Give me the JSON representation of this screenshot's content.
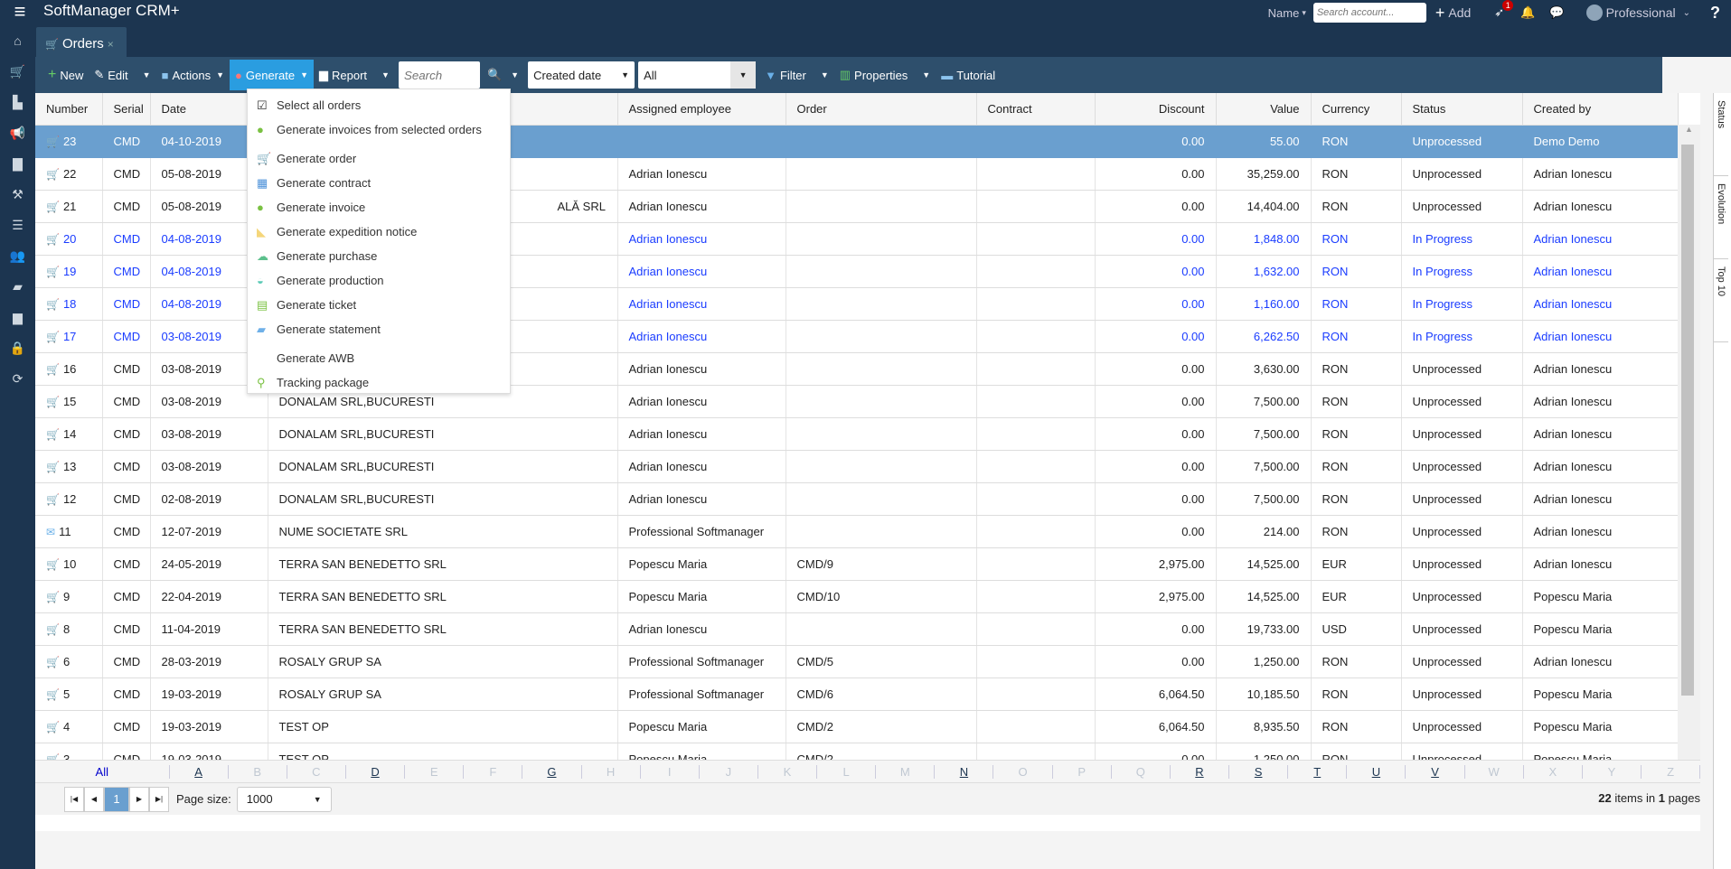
{
  "app": {
    "title": "SoftManager CRM+",
    "menu_icon": "hamburger-icon"
  },
  "header": {
    "name_label": "Name",
    "search_placeholder": "Search account...",
    "add_label": "Add",
    "notif_badge": "1",
    "user": "Professional",
    "help": "?"
  },
  "tab": {
    "label": "Orders",
    "close": "×"
  },
  "sidebar": [
    "home-icon",
    "cart-icon",
    "chart-icon",
    "megaphone-icon",
    "briefcase-icon",
    "hammer-icon",
    "database-icon",
    "users-icon",
    "folder-icon",
    "printer-icon",
    "lock-icon",
    "refresh-icon"
  ],
  "toolbar": {
    "new": "New",
    "edit": "Edit",
    "actions": "Actions",
    "generate": "Generate",
    "report": "Report",
    "search_placeholder": "Search",
    "date_filter": "Created date",
    "period": "All",
    "filter": "Filter",
    "properties": "Properties",
    "tutorial": "Tutorial"
  },
  "generate_menu": [
    {
      "label": "Select all orders",
      "icon": "checkbox-icon",
      "glyph": "☑",
      "color": "#333"
    },
    {
      "label": "Generate invoices from selected orders",
      "icon": "money-bag-icon",
      "glyph": "●",
      "color": "#7ac142"
    },
    {
      "label": "Generate order",
      "icon": "cart-icon",
      "glyph": "🛒",
      "color": "#36b39a",
      "gap": true
    },
    {
      "label": "Generate contract",
      "icon": "contract-icon",
      "glyph": "▦",
      "color": "#4a90d9"
    },
    {
      "label": "Generate invoice",
      "icon": "money-bag-icon",
      "glyph": "●",
      "color": "#7ac142"
    },
    {
      "label": "Generate expedition notice",
      "icon": "dolly-icon",
      "glyph": "◣",
      "color": "#f5d67a"
    },
    {
      "label": "Generate purchase",
      "icon": "cloud-upload-icon",
      "glyph": "☁",
      "color": "#5cc08c"
    },
    {
      "label": "Generate production",
      "icon": "helmet-icon",
      "glyph": "◒",
      "color": "#5ccab6"
    },
    {
      "label": "Generate ticket",
      "icon": "ticket-icon",
      "glyph": "▤",
      "color": "#7ac142"
    },
    {
      "label": "Generate statement",
      "icon": "statement-icon",
      "glyph": "▰",
      "color": "#6fb0e8"
    },
    {
      "label": "Generate AWB",
      "icon": "",
      "glyph": "",
      "color": "#333",
      "gap": true
    },
    {
      "label": "Tracking package",
      "icon": "location-pin-icon",
      "glyph": "⚲",
      "color": "#7ac142"
    }
  ],
  "table": {
    "columns": [
      "Number",
      "Serial",
      "Date",
      "",
      "Assigned employee",
      "Order",
      "Contract",
      "Discount",
      "Value",
      "Currency",
      "Status",
      "Created by"
    ],
    "rows": [
      {
        "n": "23",
        "s": "CMD",
        "d": "04-10-2019",
        "c": "",
        "e": "",
        "o": "",
        "k": "",
        "disc": "0.00",
        "v": "55.00",
        "cur": "RON",
        "st": "Unprocessed",
        "by": "Demo Demo",
        "sel": true
      },
      {
        "n": "22",
        "s": "CMD",
        "d": "05-08-2019",
        "c": "",
        "e": "Adrian Ionescu",
        "o": "",
        "k": "",
        "disc": "0.00",
        "v": "35,259.00",
        "cur": "RON",
        "st": "Unprocessed",
        "by": "Adrian Ionescu"
      },
      {
        "n": "21",
        "s": "CMD",
        "d": "05-08-2019",
        "c": "ALĂ SRL",
        "e": "Adrian Ionescu",
        "o": "",
        "k": "",
        "disc": "0.00",
        "v": "14,404.00",
        "cur": "RON",
        "st": "Unprocessed",
        "by": "Adrian Ionescu"
      },
      {
        "n": "20",
        "s": "CMD",
        "d": "04-08-2019",
        "c": "",
        "e": "Adrian Ionescu",
        "o": "",
        "k": "",
        "disc": "0.00",
        "v": "1,848.00",
        "cur": "RON",
        "st": "In Progress",
        "by": "Adrian Ionescu",
        "prog": true
      },
      {
        "n": "19",
        "s": "CMD",
        "d": "04-08-2019",
        "c": "",
        "e": "Adrian Ionescu",
        "o": "",
        "k": "",
        "disc": "0.00",
        "v": "1,632.00",
        "cur": "RON",
        "st": "In Progress",
        "by": "Adrian Ionescu",
        "prog": true
      },
      {
        "n": "18",
        "s": "CMD",
        "d": "04-08-2019",
        "c": "",
        "e": "Adrian Ionescu",
        "o": "",
        "k": "",
        "disc": "0.00",
        "v": "1,160.00",
        "cur": "RON",
        "st": "In Progress",
        "by": "Adrian Ionescu",
        "prog": true
      },
      {
        "n": "17",
        "s": "CMD",
        "d": "03-08-2019",
        "c": "",
        "e": "Adrian Ionescu",
        "o": "",
        "k": "",
        "disc": "0.00",
        "v": "6,262.50",
        "cur": "RON",
        "st": "In Progress",
        "by": "Adrian Ionescu",
        "prog": true
      },
      {
        "n": "16",
        "s": "CMD",
        "d": "03-08-2019",
        "c": "",
        "e": "Adrian Ionescu",
        "o": "",
        "k": "",
        "disc": "0.00",
        "v": "3,630.00",
        "cur": "RON",
        "st": "Unprocessed",
        "by": "Adrian Ionescu"
      },
      {
        "n": "15",
        "s": "CMD",
        "d": "03-08-2019",
        "c": "DONALAM SRL,BUCURESTI",
        "e": "Adrian Ionescu",
        "o": "",
        "k": "",
        "disc": "0.00",
        "v": "7,500.00",
        "cur": "RON",
        "st": "Unprocessed",
        "by": "Adrian Ionescu"
      },
      {
        "n": "14",
        "s": "CMD",
        "d": "03-08-2019",
        "c": "DONALAM SRL,BUCURESTI",
        "e": "Adrian Ionescu",
        "o": "",
        "k": "",
        "disc": "0.00",
        "v": "7,500.00",
        "cur": "RON",
        "st": "Unprocessed",
        "by": "Adrian Ionescu"
      },
      {
        "n": "13",
        "s": "CMD",
        "d": "03-08-2019",
        "c": "DONALAM SRL,BUCURESTI",
        "e": "Adrian Ionescu",
        "o": "",
        "k": "",
        "disc": "0.00",
        "v": "7,500.00",
        "cur": "RON",
        "st": "Unprocessed",
        "by": "Adrian Ionescu"
      },
      {
        "n": "12",
        "s": "CMD",
        "d": "02-08-2019",
        "c": "DONALAM SRL,BUCURESTI",
        "e": "Adrian Ionescu",
        "o": "",
        "k": "",
        "disc": "0.00",
        "v": "7,500.00",
        "cur": "RON",
        "st": "Unprocessed",
        "by": "Adrian Ionescu"
      },
      {
        "n": "11",
        "s": "CMD",
        "d": "12-07-2019",
        "c": "NUME SOCIETATE SRL",
        "e": "Professional Softmanager",
        "o": "",
        "k": "",
        "disc": "0.00",
        "v": "214.00",
        "cur": "RON",
        "st": "Unprocessed",
        "by": "Adrian Ionescu",
        "mail": true
      },
      {
        "n": "10",
        "s": "CMD",
        "d": "24-05-2019",
        "c": "TERRA SAN BENEDETTO SRL",
        "e": "Popescu Maria",
        "o": "CMD/9",
        "k": "",
        "disc": "2,975.00",
        "v": "14,525.00",
        "cur": "EUR",
        "st": "Unprocessed",
        "by": "Adrian Ionescu"
      },
      {
        "n": "9",
        "s": "CMD",
        "d": "22-04-2019",
        "c": "TERRA SAN BENEDETTO SRL",
        "e": "Popescu Maria",
        "o": "CMD/10",
        "k": "",
        "disc": "2,975.00",
        "v": "14,525.00",
        "cur": "EUR",
        "st": "Unprocessed",
        "by": "Popescu Maria"
      },
      {
        "n": "8",
        "s": "CMD",
        "d": "11-04-2019",
        "c": "TERRA SAN BENEDETTO SRL",
        "e": "Adrian Ionescu",
        "o": "",
        "k": "",
        "disc": "0.00",
        "v": "19,733.00",
        "cur": "USD",
        "st": "Unprocessed",
        "by": "Popescu Maria"
      },
      {
        "n": "6",
        "s": "CMD",
        "d": "28-03-2019",
        "c": "ROSALY GRUP SA",
        "e": "Professional Softmanager",
        "o": "CMD/5",
        "k": "",
        "disc": "0.00",
        "v": "1,250.00",
        "cur": "RON",
        "st": "Unprocessed",
        "by": "Adrian Ionescu"
      },
      {
        "n": "5",
        "s": "CMD",
        "d": "19-03-2019",
        "c": "ROSALY GRUP SA",
        "e": "Professional Softmanager",
        "o": "CMD/6",
        "k": "",
        "disc": "6,064.50",
        "v": "10,185.50",
        "cur": "RON",
        "st": "Unprocessed",
        "by": "Popescu Maria"
      },
      {
        "n": "4",
        "s": "CMD",
        "d": "19-03-2019",
        "c": "TEST OP",
        "e": "Popescu Maria",
        "o": "CMD/2",
        "k": "",
        "disc": "6,064.50",
        "v": "8,935.50",
        "cur": "RON",
        "st": "Unprocessed",
        "by": "Popescu Maria"
      },
      {
        "n": "3",
        "s": "CMD",
        "d": "19-03-2019",
        "c": "TEST OP",
        "e": "Popescu Maria",
        "o": "CMD/2",
        "k": "",
        "disc": "0.00",
        "v": "1,250.00",
        "cur": "RON",
        "st": "Unprocessed",
        "by": "Popescu Maria"
      }
    ]
  },
  "alphabet": {
    "all": "All",
    "letters": [
      "A",
      "B",
      "C",
      "D",
      "E",
      "F",
      "G",
      "H",
      "I",
      "J",
      "K",
      "L",
      "M",
      "N",
      "O",
      "P",
      "Q",
      "R",
      "S",
      "T",
      "U",
      "V",
      "W",
      "X",
      "Y",
      "Z"
    ],
    "active": [
      "A",
      "D",
      "G",
      "N",
      "R",
      "S",
      "T",
      "U",
      "V"
    ]
  },
  "pager": {
    "page": "1",
    "page_size_label": "Page size:",
    "page_size": "1000",
    "items_count": "22",
    "items_mid": " items in ",
    "pages_count": "1",
    "pages_suffix": " pages"
  },
  "right_panel": [
    "Status",
    "Evolution",
    "Top 10"
  ],
  "colors": {
    "topbar": "#1c3550",
    "toolbar": "#2e4f6c",
    "accent": "#2a9de0",
    "selected_row": "#6a9fcf",
    "in_progress": "#1a3cff"
  }
}
